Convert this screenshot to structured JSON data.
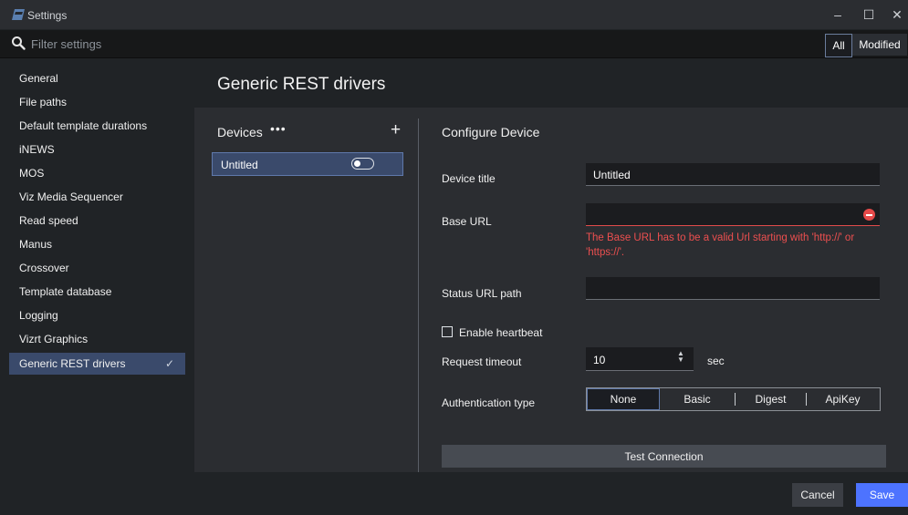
{
  "window": {
    "title": "Settings",
    "icon": "settings-app-icon"
  },
  "filter": {
    "placeholder": "Filter settings",
    "value": "",
    "all_label": "All",
    "modified_label": "Modified",
    "selected": "All"
  },
  "sidebar": {
    "items": [
      {
        "label": "General"
      },
      {
        "label": "File paths"
      },
      {
        "label": "Default template durations"
      },
      {
        "label": "iNEWS"
      },
      {
        "label": "MOS"
      },
      {
        "label": "Viz Media Sequencer"
      },
      {
        "label": "Read speed"
      },
      {
        "label": "Manus"
      },
      {
        "label": "Crossover"
      },
      {
        "label": "Template database"
      },
      {
        "label": "Logging"
      },
      {
        "label": "Vizrt Graphics"
      },
      {
        "label": "Generic REST drivers",
        "active": true
      }
    ]
  },
  "main": {
    "title": "Generic REST drivers",
    "devices": {
      "title": "Devices",
      "more_icon": "•••",
      "add_icon": "+",
      "items": [
        {
          "label": "Untitled",
          "enabled": false
        }
      ]
    },
    "configure": {
      "title": "Configure Device",
      "device_title_label": "Device title",
      "device_title_value": "Untitled",
      "base_url_label": "Base URL",
      "base_url_value": "",
      "base_url_error": "The Base URL has to be a valid Url starting with 'http://' or 'https://'.",
      "status_url_label": "Status URL path",
      "status_url_value": "",
      "heartbeat_label": "Enable heartbeat",
      "heartbeat_checked": false,
      "timeout_label": "Request timeout",
      "timeout_value": "10",
      "timeout_unit": "sec",
      "auth_label": "Authentication type",
      "auth_options": [
        "None",
        "Basic",
        "Digest",
        "ApiKey"
      ],
      "auth_selected": "None",
      "test_button": "Test Connection"
    }
  },
  "footer": {
    "cancel_label": "Cancel",
    "save_label": "Save"
  },
  "colors": {
    "accent": "#4d73ff",
    "selection": "#3a4a6b",
    "error": "#ec4f4f"
  }
}
